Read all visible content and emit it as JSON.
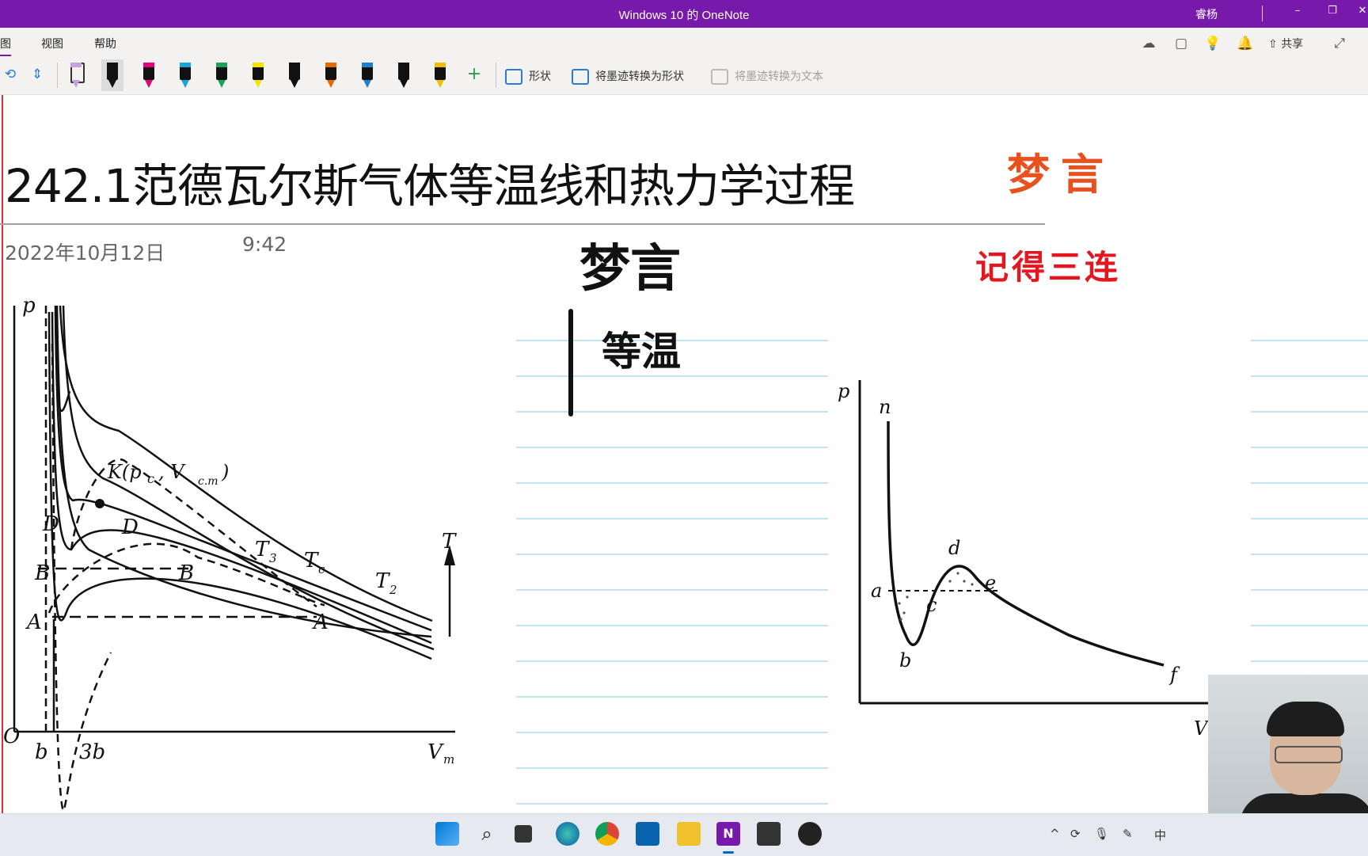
{
  "titlebar": {
    "title": "Windows 10 的 OneNote",
    "user": "睿杨",
    "min": "–",
    "restore": "❐",
    "close": "✕"
  },
  "menubar": {
    "items": [
      "图",
      "视图",
      "帮助"
    ],
    "share": "共享"
  },
  "ribbon": {
    "shape_label": "形状",
    "ink_to_shape_label": "将墨迹转换为形状",
    "ink_to_text_label": "将墨迹转换为文本",
    "add_pen": "+",
    "pen_colors": [
      "#c9a0dc",
      "#111111",
      "#e3007d",
      "#1aa3d9",
      "#19a45a",
      "#f2e600",
      "#111111",
      "#e46a00",
      "#1f7fd1",
      "#111111",
      "#f0c000"
    ]
  },
  "page": {
    "title": "242.1范德瓦尔斯气体等温线和热力学过程",
    "date": "2022年10月12日",
    "time": "9:42"
  },
  "ink": {
    "orange": "梦言",
    "red": "记得三连",
    "black1": "梦言",
    "black2": "等温"
  },
  "figure1": {
    "p": "p",
    "K": "K(p",
    "c": "c",
    "Vcm": ", V",
    "cm": "c.m",
    "close": ")",
    "D": "D",
    "D2": "D",
    "B": "B",
    "B2": "B",
    "A": "A",
    "A2": "A",
    "T3": "T",
    "T3s": "3",
    "Tc": "T",
    "Tcs": "c",
    "T2": "T",
    "T2s": "2",
    "T": "T",
    "O": "O",
    "b": "b",
    "3b": "3b",
    "Vm": "V",
    "Vms": "m"
  },
  "figure2": {
    "p": "p",
    "n": "n",
    "a": "a",
    "b": "b",
    "c": "c",
    "d": "d",
    "e": "e",
    "f": "f",
    "V": "V"
  },
  "tray": {
    "ime": "中"
  }
}
